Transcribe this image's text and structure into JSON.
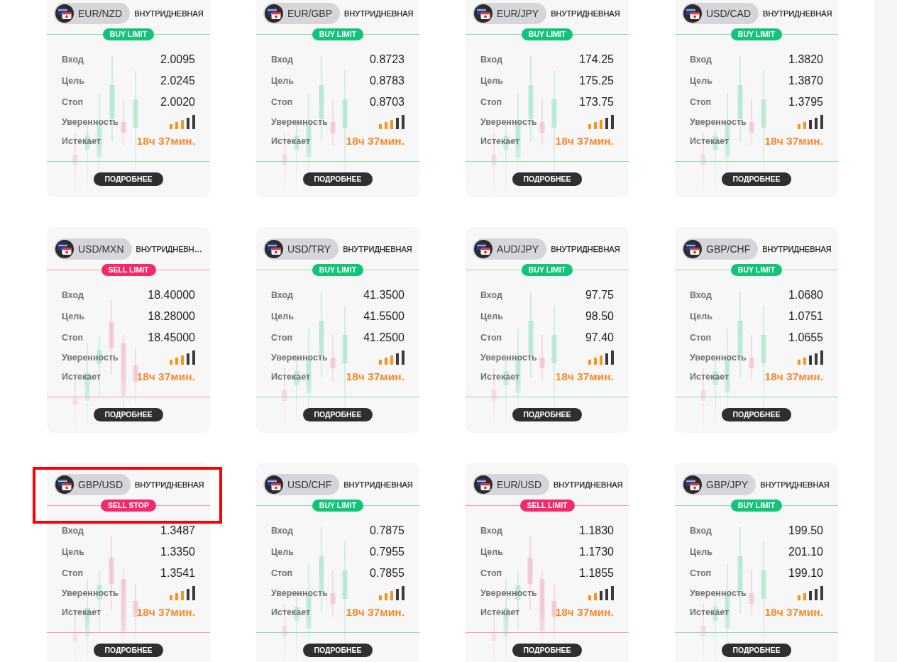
{
  "cards": [
    {
      "pair": "EUR/NZD",
      "timeframe": "ВНУТРИДНЕВНАЯ",
      "order": {
        "label": "BUY LIMIT",
        "kind": "buy"
      },
      "rows": [
        {
          "label": "Вход",
          "value": "2.0095"
        },
        {
          "label": "Цель",
          "value": "2.0245"
        },
        {
          "label": "Стоп",
          "value": "2.0020"
        }
      ],
      "confidence": {
        "label": "Уверенность",
        "level": 0.6
      },
      "expires": {
        "label": "Истекает",
        "value": "18ч 37мин."
      },
      "button": "ПОДРОБНЕЕ",
      "highlighted": false
    },
    {
      "pair": "EUR/GBP",
      "timeframe": "ВНУТРИДНЕВНАЯ",
      "order": {
        "label": "BUY LIMIT",
        "kind": "buy"
      },
      "rows": [
        {
          "label": "Вход",
          "value": "0.8723"
        },
        {
          "label": "Цель",
          "value": "0.8783"
        },
        {
          "label": "Стоп",
          "value": "0.8703"
        }
      ],
      "confidence": {
        "label": "Уверенность",
        "level": 0.6
      },
      "expires": {
        "label": "Истекает",
        "value": "18ч 37мин."
      },
      "button": "ПОДРОБНЕЕ",
      "highlighted": false
    },
    {
      "pair": "EUR/JPY",
      "timeframe": "ВНУТРИДНЕВНАЯ",
      "order": {
        "label": "BUY LIMIT",
        "kind": "buy"
      },
      "rows": [
        {
          "label": "Вход",
          "value": "174.25"
        },
        {
          "label": "Цель",
          "value": "175.25"
        },
        {
          "label": "Стоп",
          "value": "173.75"
        }
      ],
      "confidence": {
        "label": "Уверенность",
        "level": 0.6
      },
      "expires": {
        "label": "Истекает",
        "value": "18ч 37мин."
      },
      "button": "ПОДРОБНЕЕ",
      "highlighted": false
    },
    {
      "pair": "USD/CAD",
      "timeframe": "ВНУТРИДНЕВНАЯ",
      "order": {
        "label": "BUY LIMIT",
        "kind": "buy"
      },
      "rows": [
        {
          "label": "Вход",
          "value": "1.3820"
        },
        {
          "label": "Цель",
          "value": "1.3870"
        },
        {
          "label": "Стоп",
          "value": "1.3795"
        }
      ],
      "confidence": {
        "label": "Уверенность",
        "level": 0.4
      },
      "expires": {
        "label": "Истекает",
        "value": "18ч 37мин."
      },
      "button": "ПОДРОБНЕЕ",
      "highlighted": false
    },
    {
      "pair": "USD/MXN",
      "timeframe": "ВНУТРИДНЕВН…",
      "order": {
        "label": "SELL LIMIT",
        "kind": "sell"
      },
      "rows": [
        {
          "label": "Вход",
          "value": "18.40000"
        },
        {
          "label": "Цель",
          "value": "18.28000"
        },
        {
          "label": "Стоп",
          "value": "18.45000"
        }
      ],
      "confidence": {
        "label": "Уверенность",
        "level": 0.6
      },
      "expires": {
        "label": "Истекает",
        "value": "18ч 37мин."
      },
      "button": "ПОДРОБНЕЕ",
      "highlighted": false
    },
    {
      "pair": "USD/TRY",
      "timeframe": "ВНУТРИДНЕВНАЯ",
      "order": {
        "label": "BUY LIMIT",
        "kind": "buy"
      },
      "rows": [
        {
          "label": "Вход",
          "value": "41.3500"
        },
        {
          "label": "Цель",
          "value": "41.5500"
        },
        {
          "label": "Стоп",
          "value": "41.2500"
        }
      ],
      "confidence": {
        "label": "Уверенность",
        "level": 0.6
      },
      "expires": {
        "label": "Истекает",
        "value": "18ч 37мин."
      },
      "button": "ПОДРОБНЕЕ",
      "highlighted": false
    },
    {
      "pair": "AUD/JPY",
      "timeframe": "ВНУТРИДНЕВНАЯ",
      "order": {
        "label": "BUY LIMIT",
        "kind": "buy"
      },
      "rows": [
        {
          "label": "Вход",
          "value": "97.75"
        },
        {
          "label": "Цель",
          "value": "98.50"
        },
        {
          "label": "Стоп",
          "value": "97.40"
        }
      ],
      "confidence": {
        "label": "Уверенность",
        "level": 0.6
      },
      "expires": {
        "label": "Истекает",
        "value": "18ч 37мин."
      },
      "button": "ПОДРОБНЕЕ",
      "highlighted": false
    },
    {
      "pair": "GBP/CHF",
      "timeframe": "ВНУТРИДНЕВНАЯ",
      "order": {
        "label": "BUY LIMIT",
        "kind": "buy"
      },
      "rows": [
        {
          "label": "Вход",
          "value": "1.0680"
        },
        {
          "label": "Цель",
          "value": "1.0751"
        },
        {
          "label": "Стоп",
          "value": "1.0655"
        }
      ],
      "confidence": {
        "label": "Уверенность",
        "level": 0.4
      },
      "expires": {
        "label": "Истекает",
        "value": "18ч 37мин."
      },
      "button": "ПОДРОБНЕЕ",
      "highlighted": false
    },
    {
      "pair": "GBP/USD",
      "timeframe": "ВНУТРИДНЕВНАЯ",
      "order": {
        "label": "SELL STOP",
        "kind": "sell"
      },
      "rows": [
        {
          "label": "Вход",
          "value": "1.3487"
        },
        {
          "label": "Цель",
          "value": "1.3350"
        },
        {
          "label": "Стоп",
          "value": "1.3541"
        }
      ],
      "confidence": {
        "label": "Уверенность",
        "level": 0.6
      },
      "expires": {
        "label": "Истекает",
        "value": "18ч 37мин."
      },
      "button": "ПОДРОБНЕЕ",
      "highlighted": true
    },
    {
      "pair": "USD/CHF",
      "timeframe": "ВНУТРИДНЕВНАЯ",
      "order": {
        "label": "BUY LIMIT",
        "kind": "buy"
      },
      "rows": [
        {
          "label": "Вход",
          "value": "0.7875"
        },
        {
          "label": "Цель",
          "value": "0.7955"
        },
        {
          "label": "Стоп",
          "value": "0.7855"
        }
      ],
      "confidence": {
        "label": "Уверенность",
        "level": 0.6
      },
      "expires": {
        "label": "Истекает",
        "value": "18ч 37мин."
      },
      "button": "ПОДРОБНЕЕ",
      "highlighted": false
    },
    {
      "pair": "EUR/USD",
      "timeframe": "ВНУТРИДНЕВНАЯ",
      "order": {
        "label": "SELL LIMIT",
        "kind": "sell"
      },
      "rows": [
        {
          "label": "Вход",
          "value": "1.1830"
        },
        {
          "label": "Цель",
          "value": "1.1730"
        },
        {
          "label": "Стоп",
          "value": "1.1855"
        }
      ],
      "confidence": {
        "label": "Уверенность",
        "level": 0.4
      },
      "expires": {
        "label": "Истекает",
        "value": "18ч 37мин."
      },
      "button": "ПОДРОБНЕЕ",
      "highlighted": false
    },
    {
      "pair": "GBP/JPY",
      "timeframe": "ВНУТРИДНЕВНАЯ",
      "order": {
        "label": "BUY LIMIT",
        "kind": "buy"
      },
      "rows": [
        {
          "label": "Вход",
          "value": "199.50"
        },
        {
          "label": "Цель",
          "value": "201.10"
        },
        {
          "label": "Стоп",
          "value": "199.10"
        }
      ],
      "confidence": {
        "label": "Уверенность",
        "level": 0.4
      },
      "expires": {
        "label": "Истекает",
        "value": "18ч 37мин."
      },
      "button": "ПОДРОБНЕЕ",
      "highlighted": false
    }
  ]
}
